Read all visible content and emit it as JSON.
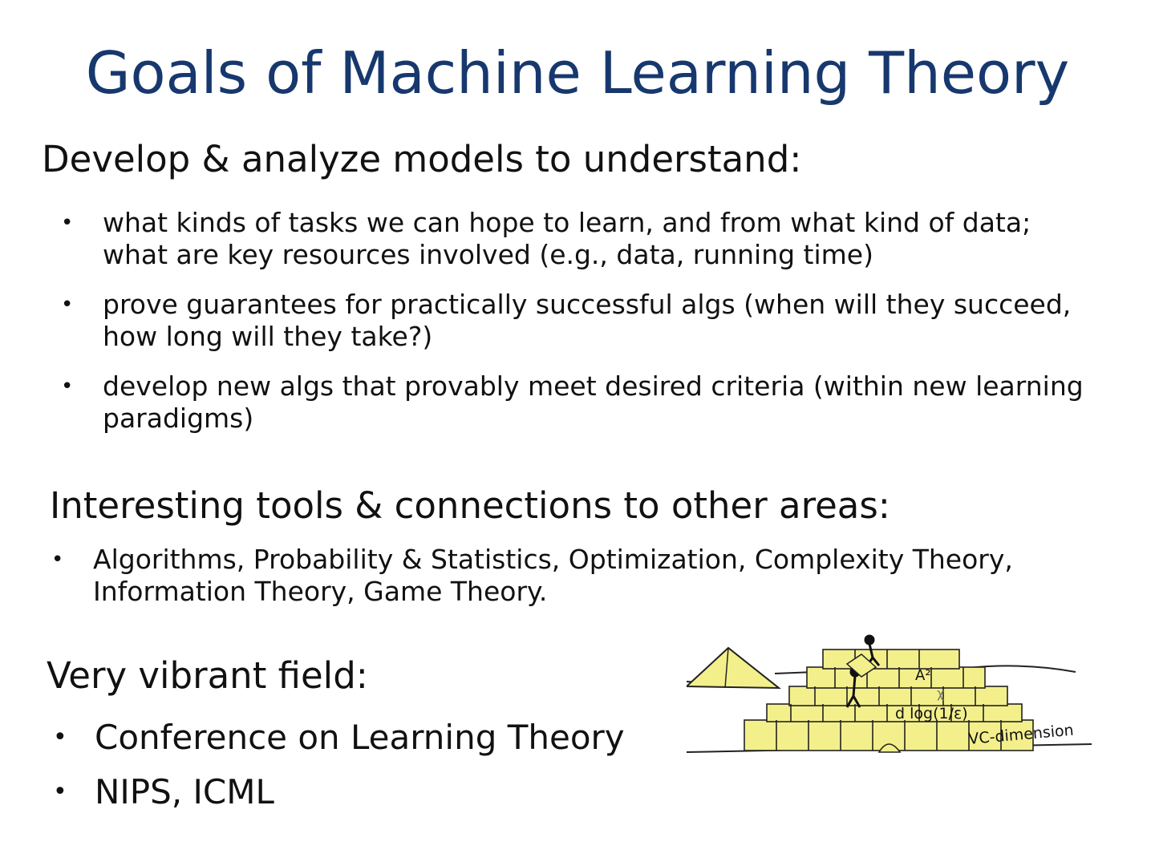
{
  "title": "Goals of Machine Learning Theory",
  "sections": [
    {
      "heading": "Develop & analyze models to understand:",
      "bullets": [
        "what kinds of tasks we can hope to learn, and from what kind of data; what are key resources involved (e.g., data, running time)",
        "prove guarantees for practically successful algs (when will they succeed, how long will they take?)",
        "develop new algs that provably meet desired criteria  (within new learning paradigms)"
      ]
    },
    {
      "heading": "Interesting  tools & connections to other areas:",
      "bullets": [
        "Algorithms, Probability & Statistics, Optimization, Complexity Theory, Information Theory, Game Theory."
      ]
    },
    {
      "heading": "Very vibrant field:",
      "bullets": [
        "Conference on Learning Theory",
        "NIPS, ICML"
      ]
    }
  ],
  "illustration": {
    "icon": "pyramid-construction-illustration",
    "labels": [
      "A²",
      "χ",
      "d log(1/ε)",
      "VC-dimension"
    ]
  },
  "colors": {
    "title": "#17386e",
    "text": "#111111",
    "pyramid_fill": "#f3f08c",
    "pyramid_stroke": "#222222"
  }
}
